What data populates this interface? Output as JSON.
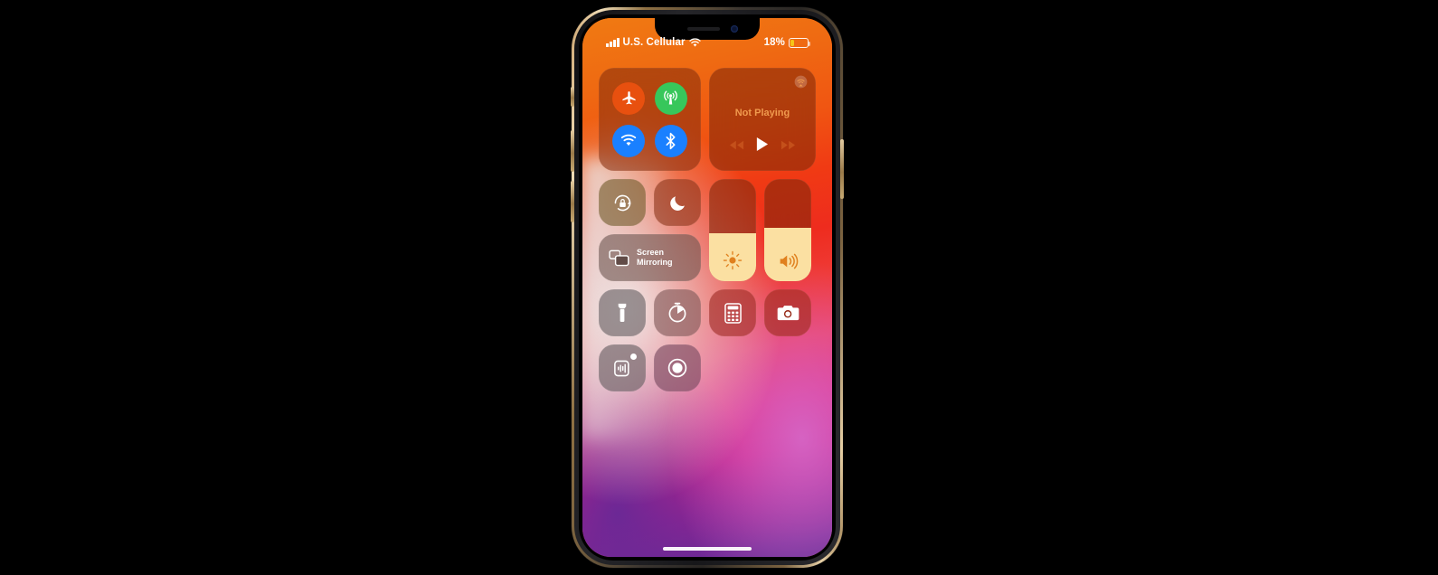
{
  "device": {
    "name": "iphone-xs",
    "frame_color": "#c9a06a",
    "buttons": {
      "silent_switch": "Silent Switch",
      "volume_up": "Volume Up",
      "volume_down": "Volume Down",
      "power": "Side Button"
    }
  },
  "status_bar": {
    "carrier": "U.S. Cellular",
    "signal_bars": 4,
    "wifi_icon": "wifi-icon",
    "battery_percent_label": "18%",
    "battery_percent": 18,
    "battery_color": "#f5c518"
  },
  "control_center": {
    "connectivity": {
      "toggles": [
        {
          "name": "airplane-mode",
          "label": "Airplane Mode",
          "icon": "airplane-icon",
          "color": "#e8500f",
          "state": "off"
        },
        {
          "name": "cellular-data",
          "label": "Cellular Data",
          "icon": "cellular-antenna-icon",
          "color": "#37c75b",
          "state": "on"
        },
        {
          "name": "wifi",
          "label": "Wi-Fi",
          "icon": "wifi-icon",
          "color": "#1a80ff",
          "state": "on"
        },
        {
          "name": "bluetooth",
          "label": "Bluetooth",
          "icon": "bluetooth-icon",
          "color": "#1a80ff",
          "state": "on"
        }
      ]
    },
    "media": {
      "title": "Not Playing",
      "title_color": "#f09a4e",
      "airplay_icon": "airplay-audio-icon",
      "controls": [
        {
          "name": "rewind",
          "label": "Rewind",
          "icon": "rewind-icon"
        },
        {
          "name": "play",
          "label": "Play",
          "icon": "play-icon"
        },
        {
          "name": "forward",
          "label": "Fast Forward",
          "icon": "forward-icon"
        }
      ]
    },
    "tiles": {
      "rotation_lock": {
        "label": "Rotation Lock",
        "icon": "rotation-lock-icon",
        "state": "on"
      },
      "do_not_disturb": {
        "label": "Do Not Disturb",
        "icon": "moon-icon",
        "state": "off"
      },
      "screen_mirroring": {
        "label_line1": "Screen",
        "label_line2": "Mirroring",
        "icon": "screen-mirroring-icon"
      },
      "flashlight": {
        "label": "Flashlight",
        "icon": "flashlight-icon"
      },
      "timer": {
        "label": "Timer",
        "icon": "timer-icon"
      },
      "calculator": {
        "label": "Calculator",
        "icon": "calculator-icon"
      },
      "camera": {
        "label": "Camera",
        "icon": "camera-icon"
      },
      "hearing": {
        "label": "Hearing",
        "icon": "hearing-icon",
        "badge": true
      },
      "screen_recording": {
        "label": "Screen Recording",
        "icon": "screen-record-icon"
      }
    },
    "sliders": [
      {
        "name": "brightness",
        "label": "Brightness",
        "icon": "brightness-sun-icon",
        "value": 47,
        "fill_color": "#fbe0a2"
      },
      {
        "name": "volume",
        "label": "Volume",
        "icon": "speaker-wave-icon",
        "value": 52,
        "fill_color": "#fbe0a2"
      }
    ]
  },
  "home_indicator": {
    "label": "Home Indicator"
  }
}
